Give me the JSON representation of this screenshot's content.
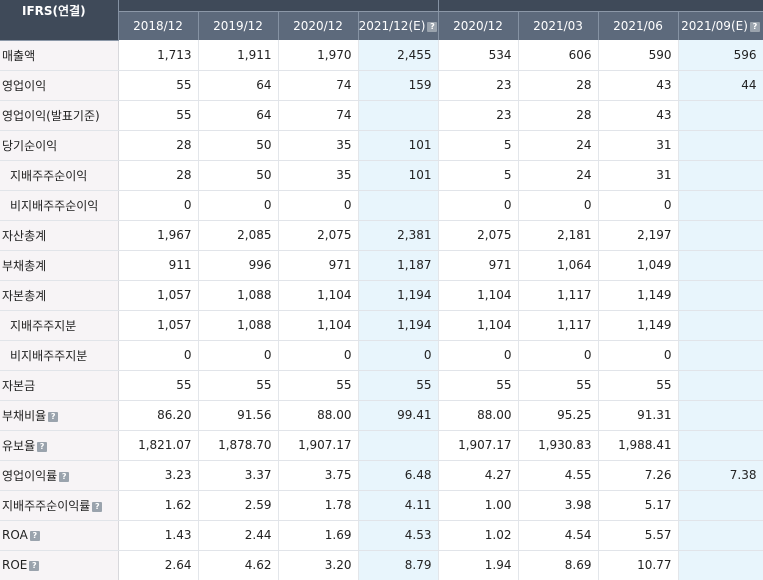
{
  "header": {
    "label_title": "IFRS(연결)",
    "columns": [
      {
        "label": "2018/12",
        "estimate": false
      },
      {
        "label": "2019/12",
        "estimate": false
      },
      {
        "label": "2020/12",
        "estimate": false
      },
      {
        "label": "2021/12(E)",
        "estimate": true
      },
      {
        "label": "2020/12",
        "estimate": false
      },
      {
        "label": "2021/03",
        "estimate": false
      },
      {
        "label": "2021/06",
        "estimate": false
      },
      {
        "label": "2021/09(E)",
        "estimate": true
      }
    ]
  },
  "colors": {
    "header_bg": "#5d6a7c",
    "label_bg": "#f7f4f6",
    "estimate_bg": "#e8f5fc",
    "help_icon": "#9aa3ad"
  },
  "rows": [
    {
      "label": "매출액",
      "indent": 0,
      "help": false,
      "values": [
        "1,713",
        "1,911",
        "1,970",
        "2,455",
        "534",
        "606",
        "590",
        "596"
      ]
    },
    {
      "label": "영업이익",
      "indent": 0,
      "help": false,
      "values": [
        "55",
        "64",
        "74",
        "159",
        "23",
        "28",
        "43",
        "44"
      ]
    },
    {
      "label": "영업이익(발표기준)",
      "indent": 0,
      "help": false,
      "values": [
        "55",
        "64",
        "74",
        "",
        "23",
        "28",
        "43",
        ""
      ]
    },
    {
      "label": "당기순이익",
      "indent": 0,
      "help": false,
      "values": [
        "28",
        "50",
        "35",
        "101",
        "5",
        "24",
        "31",
        ""
      ]
    },
    {
      "label": "지배주주순이익",
      "indent": 1,
      "help": false,
      "values": [
        "28",
        "50",
        "35",
        "101",
        "5",
        "24",
        "31",
        ""
      ]
    },
    {
      "label": "비지배주주순이익",
      "indent": 1,
      "help": false,
      "values": [
        "0",
        "0",
        "0",
        "",
        "0",
        "0",
        "0",
        ""
      ]
    },
    {
      "label": "자산총계",
      "indent": 0,
      "help": false,
      "values": [
        "1,967",
        "2,085",
        "2,075",
        "2,381",
        "2,075",
        "2,181",
        "2,197",
        ""
      ]
    },
    {
      "label": "부채총계",
      "indent": 0,
      "help": false,
      "values": [
        "911",
        "996",
        "971",
        "1,187",
        "971",
        "1,064",
        "1,049",
        ""
      ]
    },
    {
      "label": "자본총계",
      "indent": 0,
      "help": false,
      "values": [
        "1,057",
        "1,088",
        "1,104",
        "1,194",
        "1,104",
        "1,117",
        "1,149",
        ""
      ]
    },
    {
      "label": "지배주주지분",
      "indent": 1,
      "help": false,
      "values": [
        "1,057",
        "1,088",
        "1,104",
        "1,194",
        "1,104",
        "1,117",
        "1,149",
        ""
      ]
    },
    {
      "label": "비지배주주지분",
      "indent": 1,
      "help": false,
      "values": [
        "0",
        "0",
        "0",
        "0",
        "0",
        "0",
        "0",
        ""
      ]
    },
    {
      "label": "자본금",
      "indent": 0,
      "help": false,
      "values": [
        "55",
        "55",
        "55",
        "55",
        "55",
        "55",
        "55",
        ""
      ]
    },
    {
      "label": "부채비율",
      "indent": 0,
      "help": true,
      "values": [
        "86.20",
        "91.56",
        "88.00",
        "99.41",
        "88.00",
        "95.25",
        "91.31",
        ""
      ]
    },
    {
      "label": "유보율",
      "indent": 0,
      "help": true,
      "values": [
        "1,821.07",
        "1,878.70",
        "1,907.17",
        "",
        "1,907.17",
        "1,930.83",
        "1,988.41",
        ""
      ]
    },
    {
      "label": "영업이익률",
      "indent": 0,
      "help": true,
      "values": [
        "3.23",
        "3.37",
        "3.75",
        "6.48",
        "4.27",
        "4.55",
        "7.26",
        "7.38"
      ]
    },
    {
      "label": "지배주주순이익률",
      "indent": 0,
      "help": true,
      "values": [
        "1.62",
        "2.59",
        "1.78",
        "4.11",
        "1.00",
        "3.98",
        "5.17",
        ""
      ]
    },
    {
      "label": "ROA",
      "indent": 0,
      "help": true,
      "values": [
        "1.43",
        "2.44",
        "1.69",
        "4.53",
        "1.02",
        "4.54",
        "5.57",
        ""
      ]
    },
    {
      "label": "ROE",
      "indent": 0,
      "help": true,
      "values": [
        "2.64",
        "4.62",
        "3.20",
        "8.79",
        "1.94",
        "8.69",
        "10.77",
        ""
      ]
    }
  ]
}
